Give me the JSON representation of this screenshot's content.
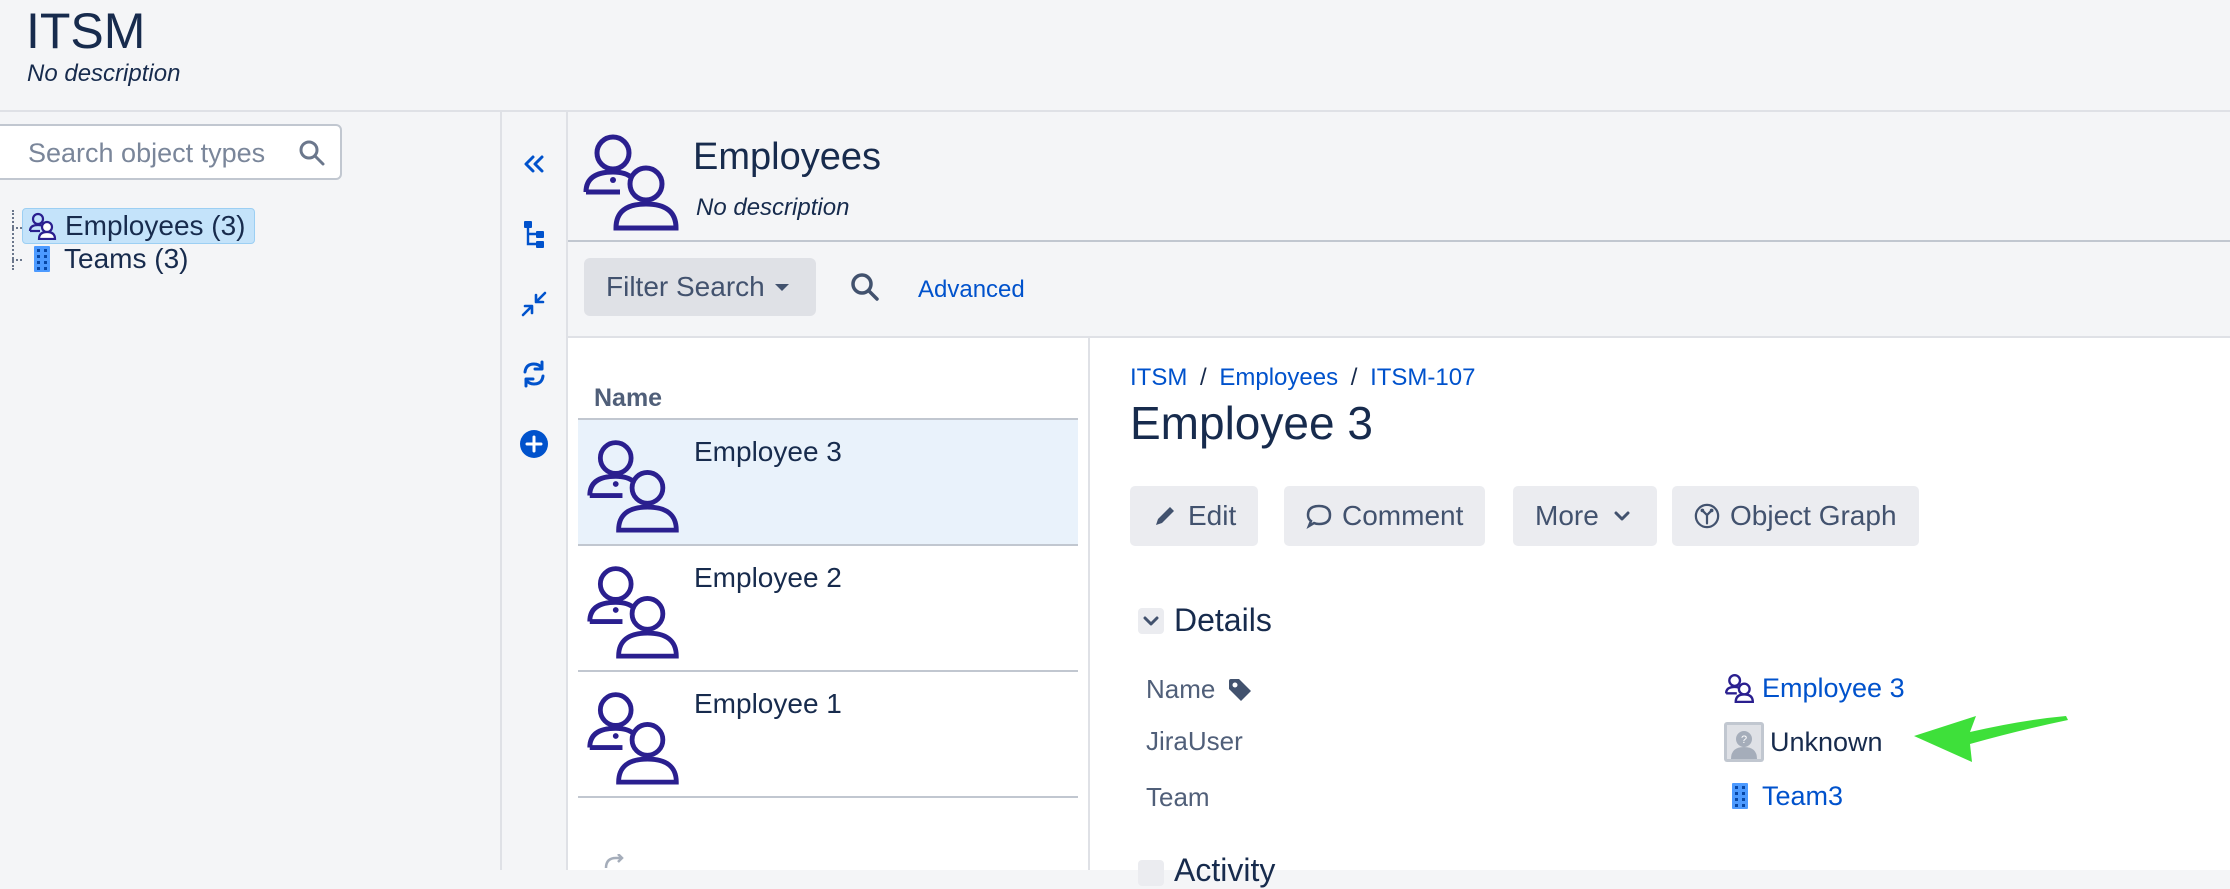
{
  "header": {
    "title": "ITSM",
    "description": "No description"
  },
  "sidebar": {
    "search_placeholder": "Search object types",
    "tree": [
      {
        "label": "Employees (3)",
        "icon": "employees-icon",
        "selected": true
      },
      {
        "label": "Teams (3)",
        "icon": "teams-icon",
        "selected": false
      }
    ]
  },
  "toolbar": {
    "icons": [
      "collapse-panel-icon",
      "hierarchy-icon",
      "shrink-icon",
      "refresh-icon",
      "add-icon"
    ]
  },
  "object_type": {
    "title": "Employees",
    "description": "No description"
  },
  "filter": {
    "button_label": "Filter Search",
    "advanced_label": "Advanced"
  },
  "list": {
    "header": "Name",
    "rows": [
      {
        "name": "Employee 3",
        "selected": true
      },
      {
        "name": "Employee 2",
        "selected": false
      },
      {
        "name": "Employee 1",
        "selected": false
      }
    ]
  },
  "detail": {
    "breadcrumb": [
      "ITSM",
      "Employees",
      "ITSM-107"
    ],
    "breadcrumb_sep": "/",
    "title": "Employee 3",
    "actions": {
      "edit": "Edit",
      "comment": "Comment",
      "more": "More",
      "graph": "Object Graph"
    },
    "section_title": "Details",
    "attributes": [
      {
        "label": "Name",
        "value": "Employee 3"
      },
      {
        "label": "JiraUser",
        "value": "Unknown"
      },
      {
        "label": "Team",
        "value": "Team3"
      }
    ],
    "activity_partial": "Activity"
  },
  "colors": {
    "accent": "#0052cc",
    "icon_navy": "#2a1f8f",
    "selected_tree": "#c4e3fa",
    "selected_row": "#e9f2fb",
    "annotation_arrow": "#3ee03a"
  }
}
